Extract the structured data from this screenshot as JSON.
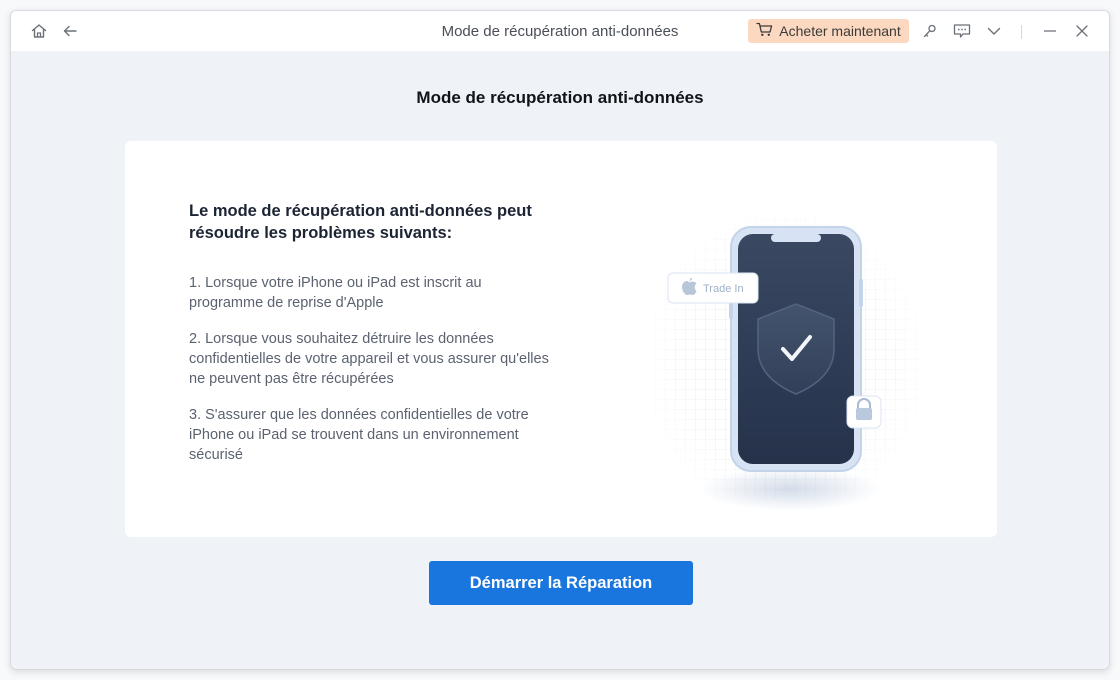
{
  "window": {
    "title": "Mode de récupération anti-données",
    "buy_label": "Acheter maintenant"
  },
  "icons": {
    "home": "home-icon",
    "back": "back-arrow-icon",
    "cart": "cart-icon",
    "key": "key-icon",
    "feedback": "feedback-icon",
    "menu": "chevron-down-icon",
    "minimize": "minimize-icon",
    "close": "close-icon"
  },
  "page": {
    "title": "Mode de récupération anti-données",
    "heading": "Le mode de récupération anti-données peut résoudre les problèmes suivants:",
    "items": [
      "1.  Lorsque votre iPhone ou iPad est inscrit au programme de reprise d'Apple",
      "2.  Lorsque vous souhaitez détruire les données confidentielles de votre appareil et vous assurer qu'elles ne peuvent pas être récupérées",
      "3.  S'assurer que les données confidentielles de votre iPhone ou iPad se trouvent dans un environnement sécurisé"
    ],
    "illustration": {
      "badge_label": "Trade In"
    },
    "start_button": "Démarrer la Réparation"
  },
  "colors": {
    "accent": "#1a76df",
    "buy_bg": "#fbd8bf",
    "phone_screen": "#2c3a52"
  }
}
